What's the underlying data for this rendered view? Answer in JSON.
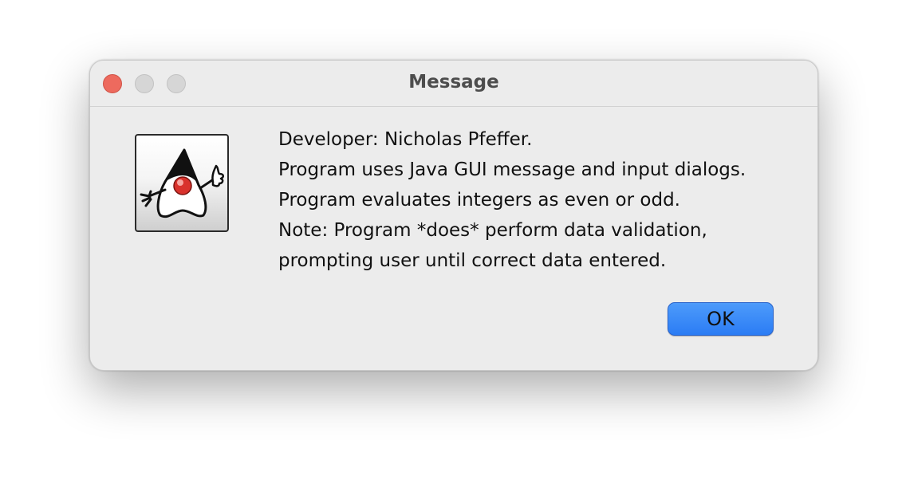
{
  "window": {
    "title": "Message"
  },
  "traffic_lights": {
    "close": "close-button",
    "minimize": "minimize-button",
    "zoom": "zoom-button"
  },
  "icon": {
    "name": "java-duke-icon"
  },
  "message": {
    "lines": [
      "Developer: Nicholas Pfeffer.",
      "Program uses Java GUI message and input dialogs.",
      "Program evaluates integers as even or odd.",
      "Note: Program *does* perform data validation,",
      "prompting user until correct data entered."
    ]
  },
  "buttons": {
    "ok_label": "OK"
  },
  "colors": {
    "accent": "#2b7cf4",
    "close": "#ed6a5e",
    "window_bg": "#ececec"
  }
}
